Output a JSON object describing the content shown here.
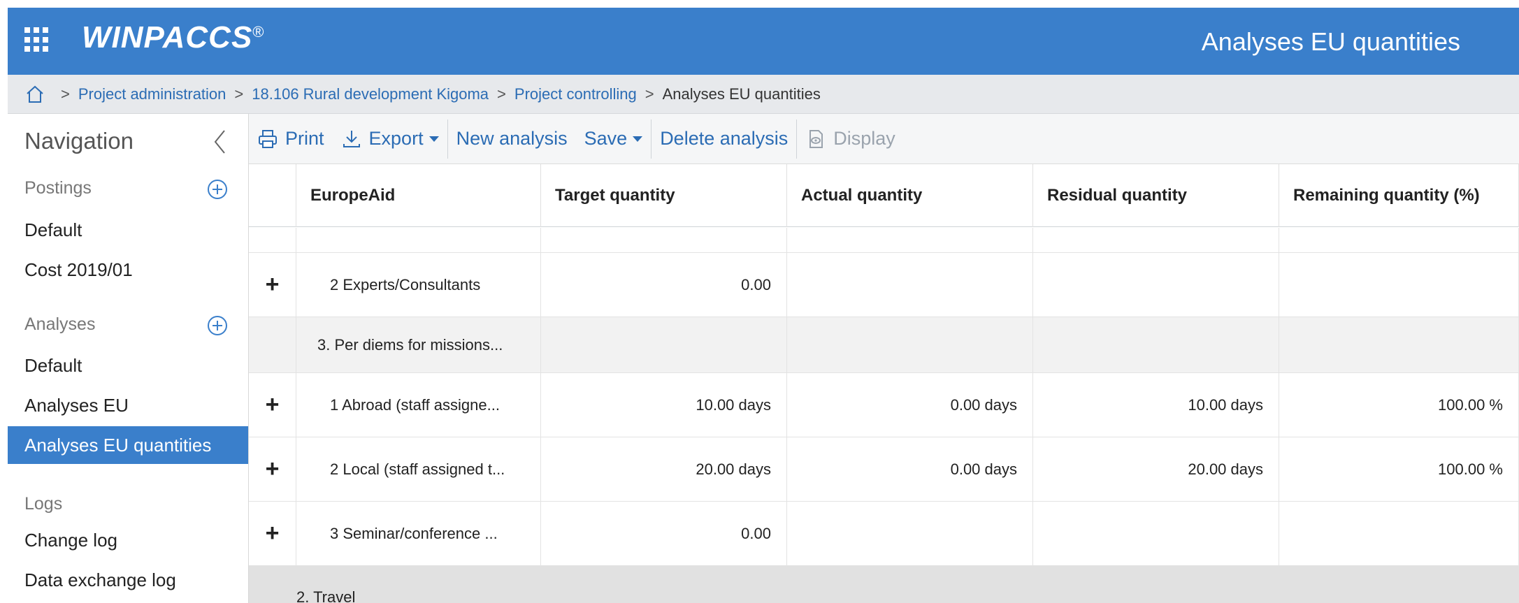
{
  "app": {
    "brand": "WINPACCS",
    "brand_mark": "®",
    "page_title": "Analyses EU quantities"
  },
  "breadcrumb": {
    "sep": ">",
    "items": [
      "Project administration",
      "18.106 Rural development Kigoma",
      "Project controlling"
    ],
    "current": "Analyses EU quantities"
  },
  "sidebar": {
    "title": "Navigation",
    "sections": [
      {
        "label": "Postings",
        "items": [
          "Default",
          "Cost 2019/01"
        ]
      },
      {
        "label": "Analyses",
        "items": [
          "Default",
          "Analyses EU",
          "Analyses EU quantities"
        ]
      },
      {
        "label": "Logs",
        "items": [
          "Change log",
          "Data exchange log"
        ]
      }
    ]
  },
  "toolbar": {
    "print": "Print",
    "export": "Export",
    "new_analysis": "New analysis",
    "save": "Save",
    "delete_analysis": "Delete analysis",
    "display": "Display"
  },
  "grid": {
    "columns": [
      "EuropeAid",
      "Target quantity",
      "Actual quantity",
      "Residual quantity",
      "Remaining quantity (%)"
    ],
    "rows": [
      {
        "expand": "+",
        "label": "2 Experts/Consultants",
        "target": "0.00",
        "actual": "",
        "residual": "",
        "remaining": ""
      },
      {
        "expand": "",
        "label": "3. Per diems for missions...",
        "target": "",
        "actual": "",
        "residual": "",
        "remaining": ""
      },
      {
        "expand": "+",
        "label": "1 Abroad (staff assigne...",
        "target": "10.00 days",
        "actual": "0.00 days",
        "residual": "10.00 days",
        "remaining": "100.00 %"
      },
      {
        "expand": "+",
        "label": "2 Local (staff assigned t...",
        "target": "20.00 days",
        "actual": "0.00 days",
        "residual": "20.00 days",
        "remaining": "100.00 %"
      },
      {
        "expand": "+",
        "label": "3 Seminar/conference ...",
        "target": "0.00",
        "actual": "",
        "residual": "",
        "remaining": ""
      }
    ],
    "group_row": "2. Travel"
  },
  "colors": {
    "brand": "#3a7fcb",
    "link": "#2b6cb4",
    "breadcrumb_bg": "#e7e9ec"
  },
  "icons": {
    "apps": "grid-icon",
    "home": "home-icon",
    "collapse": "chevron-left-icon",
    "add": "plus-circle-icon",
    "print": "printer-icon",
    "export": "download-icon",
    "display": "display-icon"
  }
}
